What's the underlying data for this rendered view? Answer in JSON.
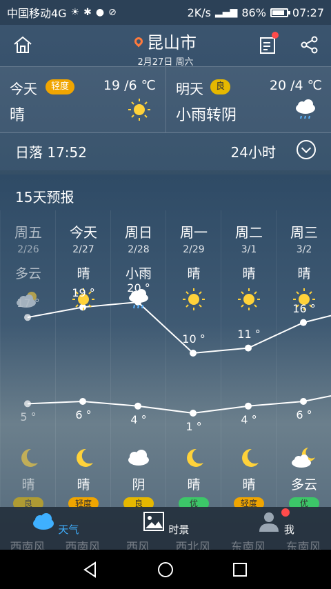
{
  "status_bar": {
    "carrier": "中国移动4G",
    "speed": "2K/s",
    "network": "4G",
    "battery": "86%",
    "battery_level": 0.86,
    "time": "07:27"
  },
  "header": {
    "city": "昆山市",
    "date": "2月27日 周六",
    "icons": [
      "home-icon",
      "news-icon",
      "share-icon"
    ]
  },
  "today": {
    "label": "今天",
    "aqi": "轻度",
    "temp": "19 /6 ℃",
    "condition": "晴",
    "icon": "sun-icon"
  },
  "tomorrow": {
    "label": "明天",
    "aqi": "良",
    "temp": "20 /4 ℃",
    "condition": "小雨转阴",
    "icon": "rain-cloud-icon"
  },
  "sunset": "日落 17:52",
  "hours_label": "24小时",
  "forecast_title": "15天预报",
  "colors": {
    "aqi_light": "#f0a500",
    "aqi_good": "#e6b800",
    "aqi_excellent": "#3cc768",
    "accent": "#3fb0ff"
  },
  "days": [
    {
      "name": "周五",
      "date": "2/26",
      "cond": "多云",
      "icon": "partly-cloudy-icon",
      "hi": "17 °",
      "lo": "5 °",
      "night_icon": "moon-icon",
      "night_cond": "晴",
      "aqi": "良",
      "aqi_level": "good",
      "wind": "西南风"
    },
    {
      "name": "今天",
      "date": "2/27",
      "cond": "晴",
      "icon": "sun-icon",
      "hi": "19 °",
      "lo": "6 °",
      "night_icon": "moon-icon",
      "night_cond": "晴",
      "aqi": "轻度",
      "aqi_level": "light",
      "wind": "西南风"
    },
    {
      "name": "周日",
      "date": "2/28",
      "cond": "小雨",
      "icon": "rain-cloud-icon",
      "hi": "20 °",
      "lo": "4 °",
      "night_icon": "cloud-icon",
      "night_cond": "阴",
      "aqi": "良",
      "aqi_level": "good",
      "wind": "西风"
    },
    {
      "name": "周一",
      "date": "2/29",
      "cond": "晴",
      "icon": "sun-icon",
      "hi": "10 °",
      "lo": "1 °",
      "night_icon": "moon-icon",
      "night_cond": "晴",
      "aqi": "优",
      "aqi_level": "excellent",
      "wind": "西北风"
    },
    {
      "name": "周二",
      "date": "3/1",
      "cond": "晴",
      "icon": "sun-icon",
      "hi": "11 °",
      "lo": "4 °",
      "night_icon": "moon-icon",
      "night_cond": "晴",
      "aqi": "轻度",
      "aqi_level": "light",
      "wind": "东南风"
    },
    {
      "name": "周三",
      "date": "3/2",
      "cond": "晴",
      "icon": "sun-icon",
      "hi": "16 °",
      "lo": "6 °",
      "night_icon": "cloudy-night-icon",
      "night_cond": "多云",
      "aqi": "优",
      "aqi_level": "excellent",
      "wind": "东南风"
    }
  ],
  "chart_data": {
    "type": "line",
    "categories": [
      "2/26",
      "2/27",
      "2/28",
      "2/29",
      "3/1",
      "3/2"
    ],
    "series": [
      {
        "values": [
          17,
          19,
          20,
          10,
          11,
          16
        ]
      },
      {
        "values": [
          5,
          6,
          4,
          1,
          4,
          6
        ]
      }
    ]
  },
  "nav": {
    "weather": "天气",
    "scenery": "时景",
    "me": "我"
  }
}
